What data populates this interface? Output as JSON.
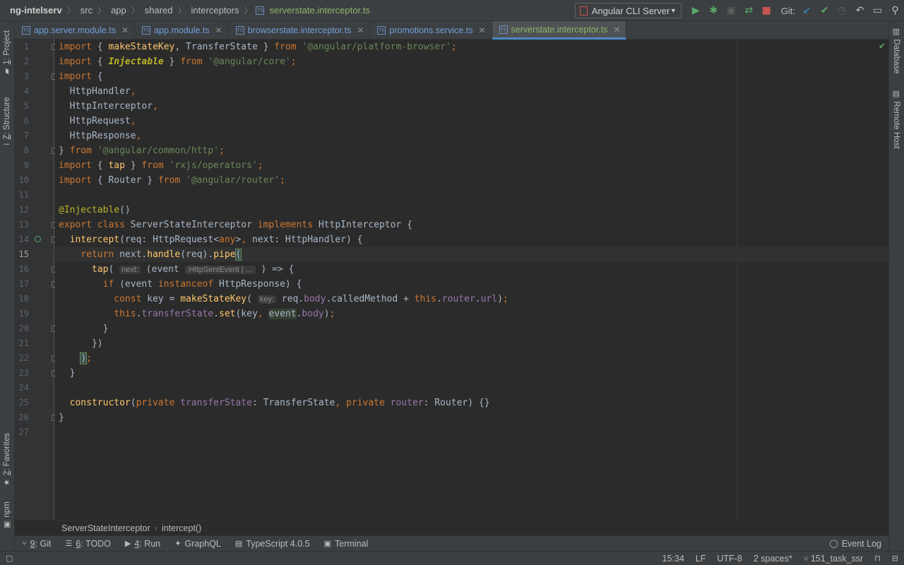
{
  "breadcrumbs": [
    "ng-intelserv",
    "src",
    "app",
    "shared",
    "interceptors",
    "serverstate.interceptor.ts"
  ],
  "run_config": "Angular CLI Server",
  "git_label": "Git:",
  "left_tools": [
    {
      "num": "1",
      "label": ": Project"
    },
    {
      "num": "Z",
      "label": ": Structure"
    },
    {
      "num": "2",
      "label": ": Favorites"
    },
    {
      "num": "",
      "label": "npm"
    }
  ],
  "right_tools": [
    "Database",
    "Remote Host"
  ],
  "tabs": [
    {
      "label": "app.server.module.ts",
      "icon": "TS"
    },
    {
      "label": "app.module.ts",
      "icon": "TS"
    },
    {
      "label": "browserstate.interceptor.ts",
      "icon": "TS"
    },
    {
      "label": "promotions.service.ts",
      "icon": "TS"
    },
    {
      "label": "serverstate.interceptor.ts",
      "icon": "TS",
      "active": true
    }
  ],
  "code": {
    "current_line": 15,
    "lines": [
      [
        [
          "k",
          "import"
        ],
        [
          "t",
          " { "
        ],
        [
          "f",
          "makeStateKey"
        ],
        [
          "t",
          ", TransferState } "
        ],
        [
          "k",
          "from "
        ],
        [
          "s",
          "'@angular/platform-browser'"
        ],
        [
          "k",
          ";"
        ]
      ],
      [
        [
          "k",
          "import"
        ],
        [
          "t",
          " { "
        ],
        [
          "an",
          "Injectable"
        ],
        [
          "t",
          " } "
        ],
        [
          "k",
          "from "
        ],
        [
          "s",
          "'@angular/core'"
        ],
        [
          "k",
          ";"
        ]
      ],
      [
        [
          "k",
          "import"
        ],
        [
          "t",
          " {"
        ]
      ],
      [
        [
          "t",
          "  HttpHandler"
        ],
        [
          "k",
          ","
        ]
      ],
      [
        [
          "t",
          "  HttpInterceptor"
        ],
        [
          "k",
          ","
        ]
      ],
      [
        [
          "t",
          "  HttpRequest"
        ],
        [
          "k",
          ","
        ]
      ],
      [
        [
          "t",
          "  HttpResponse"
        ],
        [
          "k",
          ","
        ]
      ],
      [
        [
          "t",
          "} "
        ],
        [
          "k",
          "from "
        ],
        [
          "s",
          "'@angular/common/http'"
        ],
        [
          "k",
          ";"
        ]
      ],
      [
        [
          "k",
          "import"
        ],
        [
          "t",
          " { "
        ],
        [
          "f",
          "tap"
        ],
        [
          "t",
          " } "
        ],
        [
          "k",
          "from "
        ],
        [
          "s",
          "'rxjs/operators'"
        ],
        [
          "k",
          ";"
        ]
      ],
      [
        [
          "k",
          "import"
        ],
        [
          "t",
          " { Router } "
        ],
        [
          "k",
          "from "
        ],
        [
          "s",
          "'@angular/router'"
        ],
        [
          "k",
          ";"
        ]
      ],
      [],
      [
        [
          "a",
          "@Injectable"
        ],
        [
          "t",
          "()"
        ]
      ],
      [
        [
          "k",
          "export class "
        ],
        [
          "t",
          "ServerStateInterceptor "
        ],
        [
          "k",
          "implements "
        ],
        [
          "t",
          "HttpInterceptor {"
        ]
      ],
      [
        [
          "t",
          "  "
        ],
        [
          "f",
          "intercept"
        ],
        [
          "t",
          "(req: HttpRequest<"
        ],
        [
          "k",
          "any"
        ],
        [
          "t",
          ">"
        ],
        [
          "k",
          ","
        ],
        [
          "t",
          " next: HttpHandler) {"
        ]
      ],
      [
        [
          "t",
          "    "
        ],
        [
          "k",
          "return "
        ],
        [
          "t",
          "next."
        ],
        [
          "f",
          "handle"
        ],
        [
          "t",
          "(req)."
        ],
        [
          "f",
          "pipe"
        ],
        [
          "brk",
          "("
        ]
      ],
      [
        [
          "t",
          "      "
        ],
        [
          "f",
          "tap"
        ],
        [
          "t",
          "( "
        ],
        [
          "hint",
          "next:"
        ],
        [
          "t",
          " (event "
        ],
        [
          "hint",
          ":HttpSentEvent | …"
        ],
        [
          "t",
          " ) => {"
        ]
      ],
      [
        [
          "t",
          "        "
        ],
        [
          "k",
          "if "
        ],
        [
          "t",
          "(event "
        ],
        [
          "k",
          "instanceof "
        ],
        [
          "t",
          "HttpResponse) {"
        ]
      ],
      [
        [
          "t",
          "          "
        ],
        [
          "k",
          "const "
        ],
        [
          "t",
          "key = "
        ],
        [
          "f",
          "makeStateKey"
        ],
        [
          "t",
          "( "
        ],
        [
          "hint",
          "key:"
        ],
        [
          "t",
          " req."
        ],
        [
          "p",
          "body"
        ],
        [
          "t",
          ".calledMethod + "
        ],
        [
          "k",
          "this"
        ],
        [
          "t",
          "."
        ],
        [
          "p",
          "router"
        ],
        [
          "t",
          "."
        ],
        [
          "p",
          "url"
        ],
        [
          "t",
          ")"
        ],
        [
          "k",
          ";"
        ]
      ],
      [
        [
          "t",
          "          "
        ],
        [
          "k",
          "this"
        ],
        [
          "t",
          "."
        ],
        [
          "p",
          "transferState"
        ],
        [
          "t",
          "."
        ],
        [
          "f",
          "set"
        ],
        [
          "t",
          "(key"
        ],
        [
          "k",
          ","
        ],
        [
          "t",
          " "
        ],
        [
          "hl",
          "event"
        ],
        [
          "t",
          "."
        ],
        [
          "p",
          "body"
        ],
        [
          "t",
          ")"
        ],
        [
          "k",
          ";"
        ]
      ],
      [
        [
          "t",
          "        }"
        ]
      ],
      [
        [
          "t",
          "      })"
        ]
      ],
      [
        [
          "t",
          "    "
        ],
        [
          "brk",
          ")"
        ],
        [
          "k",
          ";"
        ]
      ],
      [
        [
          "t",
          "  }"
        ]
      ],
      [],
      [
        [
          "t",
          "  "
        ],
        [
          "f",
          "constructor"
        ],
        [
          "t",
          "("
        ],
        [
          "k",
          "private "
        ],
        [
          "p",
          "transferState"
        ],
        [
          "t",
          ": TransferState"
        ],
        [
          "k",
          ","
        ],
        [
          "t",
          " "
        ],
        [
          "k",
          "private "
        ],
        [
          "p",
          "router"
        ],
        [
          "t",
          ": Router) {}"
        ]
      ],
      [
        [
          "t",
          "}"
        ]
      ],
      []
    ]
  },
  "editor_breadcrumb": [
    "ServerStateInterceptor",
    "intercept()"
  ],
  "tool_windows": [
    {
      "num": "9",
      "label": ": Git"
    },
    {
      "num": "6",
      "label": ": TODO"
    },
    {
      "num": "4",
      "label": ": Run"
    },
    {
      "num": "",
      "label": "GraphQL"
    },
    {
      "num": "",
      "label": "TypeScript 4.0.5"
    },
    {
      "num": "",
      "label": "Terminal"
    }
  ],
  "event_log": "Event Log",
  "status": {
    "position": "15:34",
    "line_sep": "LF",
    "encoding": "UTF-8",
    "indent": "2 spaces*",
    "branch": "151_task_ssr"
  }
}
